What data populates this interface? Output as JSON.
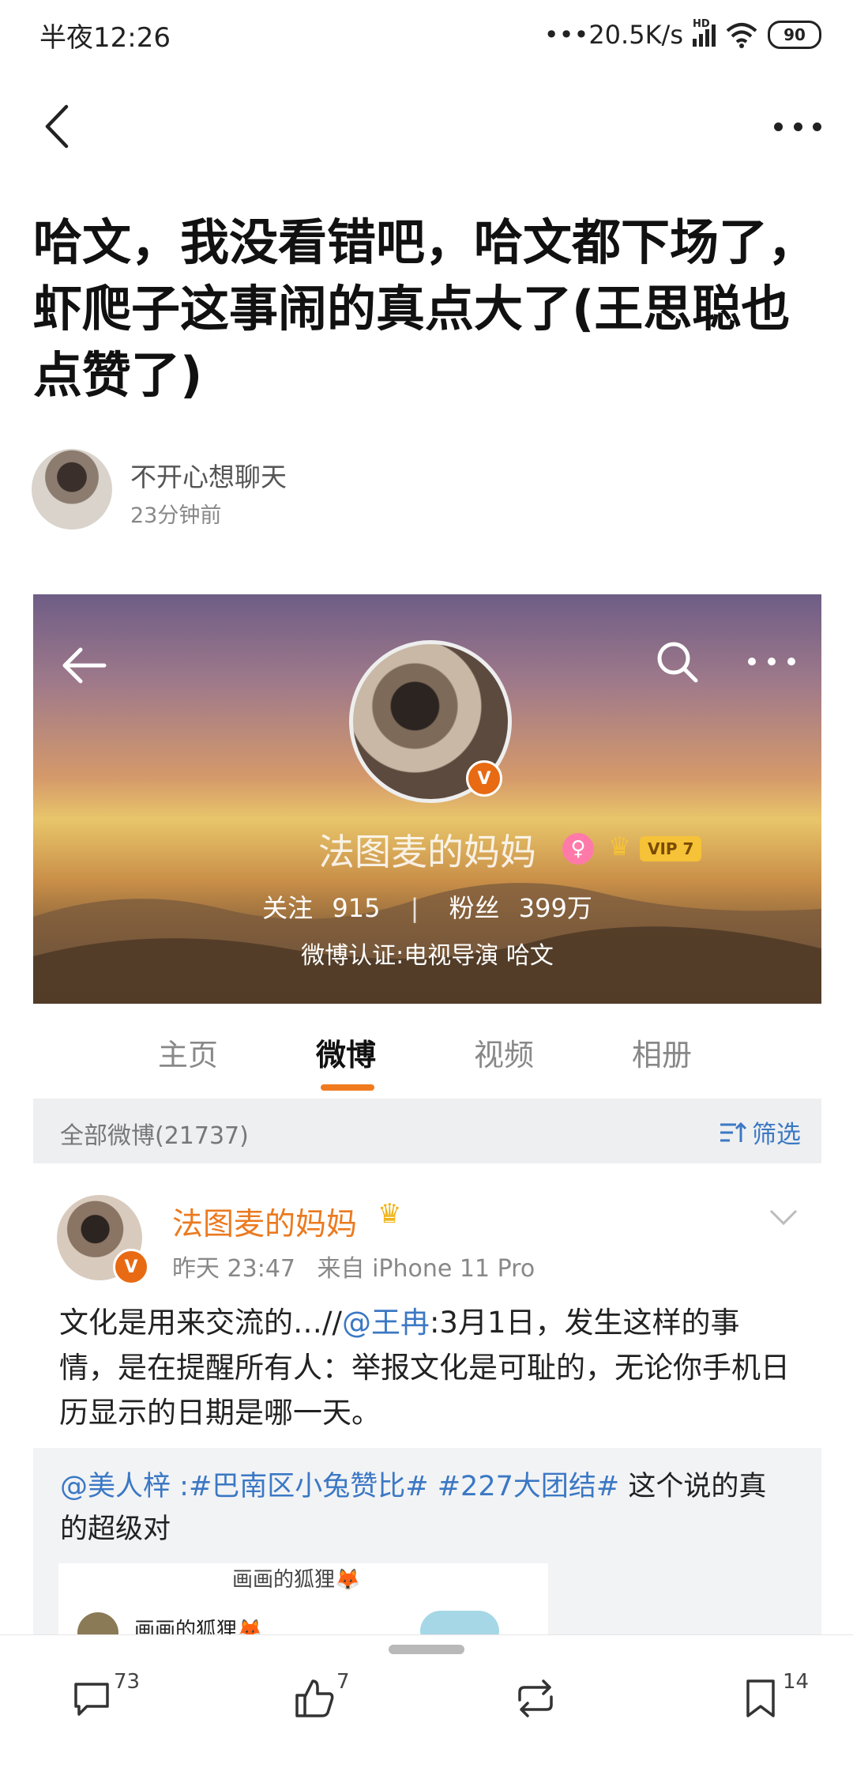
{
  "status_bar": {
    "time": "半夜12:26",
    "network_speed": "•••20.5K/s",
    "signal_label": "HD",
    "battery": "90"
  },
  "nav": {
    "back_icon": "chevron-left-icon",
    "more_icon": "more-dots-icon"
  },
  "post": {
    "title": "哈文，我没看错吧，哈文都下场了，虾爬子这事闹的真点大了(王思聪也点赞了)",
    "author": "不开心想聊天",
    "time": "23分钟前"
  },
  "profile_card": {
    "name": "法图麦的妈妈",
    "vip": "VIP 7",
    "following_label": "关注",
    "following_count": "915",
    "separator": "|",
    "followers_label": "粉丝",
    "followers_count": "399万",
    "verification": "微博认证:电视导演 哈文",
    "badge": "V"
  },
  "tabs": {
    "home": "主页",
    "weibo": "微博",
    "video": "视频",
    "album": "相册",
    "active": "微博"
  },
  "filter_bar": {
    "count_label": "全部微博(21737)",
    "filter_label": "筛选"
  },
  "weibo_post": {
    "author": "法图麦的妈妈",
    "time": "昨天 23:47",
    "source": "来自 iPhone 11 Pro",
    "text_before_mention": "文化是用来交流的…//",
    "mention": "@王冉",
    "text_after_mention": ":3月1日，发生这样的事情，是在提醒所有人：举报文化是可耻的，无论你手机日历显示的日期是哪一天。",
    "badge": "V"
  },
  "retweet": {
    "mention": "@美人梓",
    "colon": " :",
    "hashtag1": "#巴南区小兔赞比#",
    "hashtag2": "#227大团结#",
    "text": " 这个说的真的超级对",
    "image_title": "画画的狐狸🦊",
    "image_user": "画画的狐狸🦊"
  },
  "actions": {
    "comments": "73",
    "likes": "7",
    "reposts": "",
    "favorites": "14"
  },
  "colors": {
    "accent_orange": "#eb7a1f",
    "link_blue": "#3b78c4"
  }
}
